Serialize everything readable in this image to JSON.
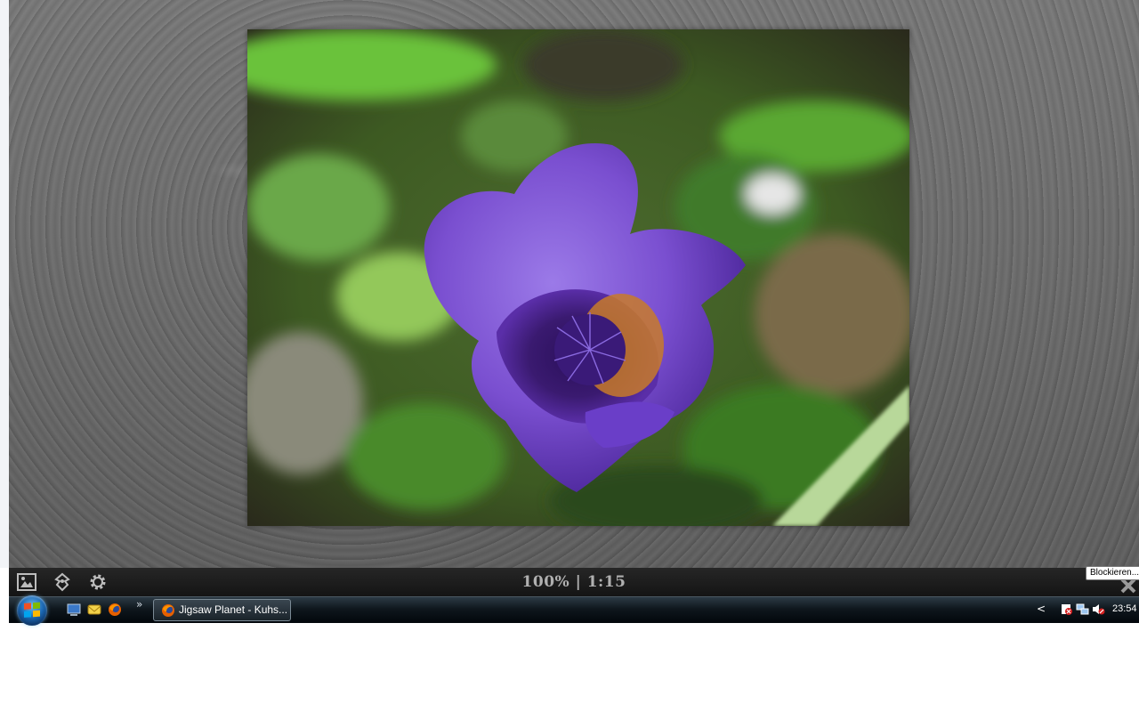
{
  "game": {
    "progress_text": "100% | 1:15",
    "toolbar_icons": [
      "image-icon",
      "ghost-image-icon",
      "gear-icon"
    ],
    "close_icon": "close-x-icon"
  },
  "tooltip": {
    "text": "Blockieren..."
  },
  "taskbar": {
    "start_icon": "windows-start-orb",
    "quick_launch": [
      "show-desktop-icon",
      "mail-icon",
      "firefox-icon"
    ],
    "quick_launch_more": "»",
    "task_button_label": "Jigsaw Planet - Kuhs...",
    "task_button_icon": "firefox-icon",
    "tray_chevron": "<",
    "tray_icons": [
      "security-alert-icon",
      "network-icon",
      "volume-muted-icon"
    ],
    "clock": "23:54"
  },
  "colors": {
    "board_gray": "#6b6b6b",
    "toolbar_dark": "#1c1c1c",
    "taskbar_dark": "#0f171d",
    "flower_purple": "#7a4fd0"
  }
}
